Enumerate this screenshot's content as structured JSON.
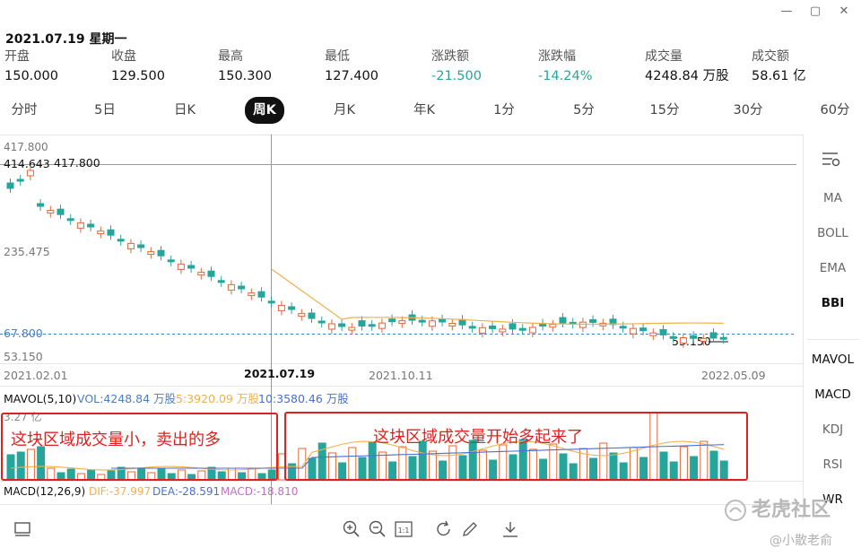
{
  "window": {
    "minimize_glyph": "—",
    "maximize_glyph": "▢",
    "close_glyph": "✕"
  },
  "header": {
    "date_line": "2021.07.19 星期一"
  },
  "quote": [
    {
      "label": "开盘",
      "value": "150.000",
      "tone": "normal"
    },
    {
      "label": "收盘",
      "value": "129.500",
      "tone": "normal"
    },
    {
      "label": "最高",
      "value": "150.300",
      "tone": "normal"
    },
    {
      "label": "最低",
      "value": "127.400",
      "tone": "normal"
    },
    {
      "label": "涨跌额",
      "value": "-21.500",
      "tone": "green"
    },
    {
      "label": "涨跌幅",
      "value": "-14.24%",
      "tone": "green"
    },
    {
      "label": "成交量",
      "value": "4248.84 万股",
      "tone": "normal"
    },
    {
      "label": "成交额",
      "value": "58.61 亿",
      "tone": "normal"
    }
  ],
  "periods": [
    "分时",
    "5日",
    "日K",
    "周K",
    "月K",
    "年K",
    "1分",
    "5分",
    "15分",
    "30分",
    "60分"
  ],
  "active_period": "周K",
  "side_panel": {
    "settings_icon": "chart-settings-icon",
    "main_indicators": [
      "MA",
      "BOLL",
      "EMA",
      "BBI"
    ],
    "active_main": "BBI",
    "sub_indicators": [
      "MAVOL",
      "MACD",
      "KDJ",
      "RSI",
      "WR"
    ],
    "active_subs": [
      "MAVOL",
      "MACD"
    ]
  },
  "colors": {
    "up": "#e0683a",
    "down": "#26a69a",
    "bbi_line": "#f0b04f",
    "vol_ma5": "#f0b04f",
    "vol_ma10": "#4a6fd4",
    "annotation": "#e02020",
    "last_price": "#4a7fc1"
  },
  "chart": {
    "price_axis": {
      "top": "417.800",
      "mid": "235.475",
      "bottom": "53.150"
    },
    "crosshair_labels": {
      "price_left": "414.643",
      "price_right": "417.800",
      "date": "2021.07.19"
    },
    "last_price_label": "67.800",
    "low_marker_label": "53.150",
    "date_labels": [
      "2021.02.01",
      "2021.10.11",
      "2022.05.09"
    ],
    "mavol_legend": {
      "title": "MAVOL(5,10)",
      "vol": "VOL:4248.84 万股",
      "ma5": "5:3920.09 万股",
      "ma10": "10:3580.46 万股"
    },
    "vol_axis_max": "3.27 亿",
    "macd_legend": {
      "title": "MACD(12,26,9)",
      "dif": "DIF:-37.997",
      "dea": "DEA:-28.591",
      "macd": "MACD:-18.810"
    },
    "annotations": [
      "这块区域成交量小，卖出的多",
      "这块区域成交量开始多起来了"
    ]
  },
  "toolbar": {
    "left": "layout-toggle-icon",
    "center": [
      "zoom-in-icon",
      "zoom-out-icon",
      "reset-scale-icon",
      "refresh-icon",
      "draw-pen-icon",
      "download-icon"
    ],
    "reset_scale_text": "1:1"
  },
  "watermark": {
    "logo": "老虎社区",
    "user": "@小散老俞"
  }
}
